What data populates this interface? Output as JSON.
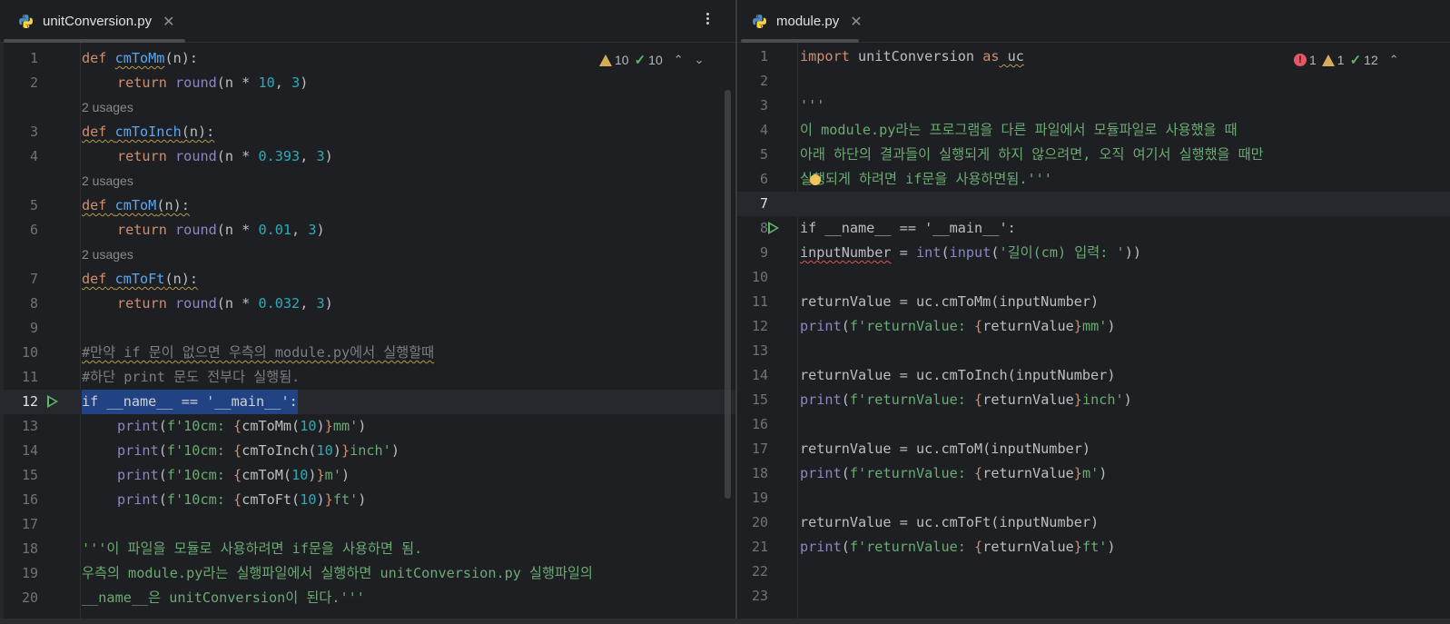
{
  "left": {
    "tab": {
      "label": "unitConversion.py",
      "close": "✕"
    },
    "inspections": {
      "warnings": "10",
      "weak_warnings": "10",
      "up": "⌃",
      "down": "⌄"
    },
    "lines": [
      {
        "n": "1"
      },
      {
        "n": "2"
      },
      {
        "usages": "2 usages"
      },
      {
        "n": "3"
      },
      {
        "n": "4"
      },
      {
        "usages": "2 usages"
      },
      {
        "n": "5"
      },
      {
        "n": "6"
      },
      {
        "usages": "2 usages"
      },
      {
        "n": "7"
      },
      {
        "n": "8"
      },
      {
        "n": "9"
      },
      {
        "n": "10"
      },
      {
        "n": "11"
      },
      {
        "n": "12"
      },
      {
        "n": "13"
      },
      {
        "n": "14"
      },
      {
        "n": "15"
      },
      {
        "n": "16"
      },
      {
        "n": "17"
      },
      {
        "n": "18"
      },
      {
        "n": "19"
      },
      {
        "n": "20"
      }
    ],
    "code": {
      "l1_def": "def",
      "l1_name": "cmToMm",
      "l1_rest": "(n):",
      "l2_return": "return",
      "l2_round": "round",
      "l2_a": "(n * ",
      "l2_num": "10",
      "l2_b": ", ",
      "l2_num2": "3",
      "l2_c": ")",
      "l3_def": "def",
      "l3_name": "cmToInch",
      "l3_rest": "(n):",
      "l4_return": "return",
      "l4_round": "round",
      "l4_a": "(n * ",
      "l4_num": "0.393",
      "l4_b": ", ",
      "l4_num2": "3",
      "l4_c": ")",
      "l5_def": "def",
      "l5_name": "cmToM",
      "l5_rest": "(n):",
      "l6_return": "return",
      "l6_round": "round",
      "l6_a": "(n * ",
      "l6_num": "0.01",
      "l6_b": ", ",
      "l6_num2": "3",
      "l6_c": ")",
      "l7_def": "def",
      "l7_name": "cmToFt",
      "l7_rest": "(n):",
      "l8_return": "return",
      "l8_round": "round",
      "l8_a": "(n * ",
      "l8_num": "0.032",
      "l8_b": ", ",
      "l8_num2": "3",
      "l8_c": ")",
      "l10": "#만약 if 문이 없으면 우측의 module.py에서 실행할때",
      "l11": "#하단 print 문도 전부다 실행됨.",
      "l12": "if __name__ == '__main__':",
      "l13_print": "print",
      "l13_a": "(",
      "l13_s1": "f'10cm: ",
      "l13_ob": "{",
      "l13_call": "cmToMm(",
      "l13_n": "10",
      "l13_cp": ")",
      "l13_cb": "}",
      "l13_s2": "mm'",
      "l13_end": ")",
      "l14_print": "print",
      "l14_a": "(",
      "l14_s1": "f'10cm: ",
      "l14_ob": "{",
      "l14_call": "cmToInch(",
      "l14_n": "10",
      "l14_cp": ")",
      "l14_cb": "}",
      "l14_s2": "inch'",
      "l14_end": ")",
      "l15_print": "print",
      "l15_a": "(",
      "l15_s1": "f'10cm: ",
      "l15_ob": "{",
      "l15_call": "cmToM(",
      "l15_n": "10",
      "l15_cp": ")",
      "l15_cb": "}",
      "l15_s2": "m'",
      "l15_end": ")",
      "l16_print": "print",
      "l16_a": "(",
      "l16_s1": "f'10cm: ",
      "l16_ob": "{",
      "l16_call": "cmToFt(",
      "l16_n": "10",
      "l16_cp": ")",
      "l16_cb": "}",
      "l16_s2": "ft'",
      "l16_end": ")",
      "l18": "'''이 파일을 모듈로 사용하려면 if문을 사용하면 됨.",
      "l19": "우측의 module.py라는 실행파일에서 실행하면 unitConversion.py 실행파일의",
      "l20": "__name__은 unitConversion이 된다.'''"
    }
  },
  "right": {
    "tab": {
      "label": "module.py",
      "close": "✕"
    },
    "inspections": {
      "errors": "1",
      "warnings": "1",
      "weak_warnings": "12",
      "up": "⌃"
    },
    "lines": [
      "1",
      "2",
      "3",
      "4",
      "5",
      "6",
      "7",
      "8",
      "9",
      "10",
      "11",
      "12",
      "13",
      "14",
      "15",
      "16",
      "17",
      "18",
      "19",
      "20",
      "21",
      "22",
      "23"
    ],
    "code": {
      "r1_import": "import",
      "r1_mod": " unitConversion ",
      "r1_as": "as",
      "r1_alias": " uc",
      "r3": "'''",
      "r4": "이 module.py라는 프로그램을 다른 파일에서 모듈파일로 사용했을 때",
      "r5": "아래 하단의 결과들이 실행되게 하지 않으려면, 오직 여기서 실행했을 때만",
      "r6": "실행되게 하려면 if문을 사용하면됨.'''",
      "r8": "if __name__ == '__main__':",
      "r9_var": "inputNumber",
      "r9_eq": " = ",
      "r9_int": "int",
      "r9_a": "(",
      "r9_input": "input",
      "r9_b": "(",
      "r9_str": "'길이(cm) 입력: '",
      "r9_c": "))",
      "r11_a": "returnValue = uc.cmToMm(inputNumber)",
      "r12_print": "print",
      "r12_a": "(",
      "r12_s1": "f'returnValue: ",
      "r12_ob": "{",
      "r12_v": "returnValue",
      "r12_cb": "}",
      "r12_s2": "mm'",
      "r12_c": ")",
      "r14_a": "returnValue = uc.cmToInch(inputNumber)",
      "r15_print": "print",
      "r15_a": "(",
      "r15_s1": "f'returnValue: ",
      "r15_ob": "{",
      "r15_v": "returnValue",
      "r15_cb": "}",
      "r15_s2": "inch'",
      "r15_c": ")",
      "r17_a": "returnValue = uc.cmToM(inputNumber)",
      "r18_print": "print",
      "r18_a": "(",
      "r18_s1": "f'returnValue: ",
      "r18_ob": "{",
      "r18_v": "returnValue",
      "r18_cb": "}",
      "r18_s2": "m'",
      "r18_c": ")",
      "r20_a": "returnValue = uc.cmToFt(inputNumber)",
      "r21_print": "print",
      "r21_a": "(",
      "r21_s1": "f'returnValue: ",
      "r21_ob": "{",
      "r21_v": "returnValue",
      "r21_cb": "}",
      "r21_s2": "ft'",
      "r21_c": ")"
    }
  },
  "colors": {
    "background": "#1e1f22",
    "keyword": "#cf8e6d",
    "function": "#56a8f5",
    "builtin": "#8888c6",
    "number": "#2aacb8",
    "string": "#6aab73",
    "comment": "#7a7e85",
    "selection": "#214283",
    "run": "#5fb865",
    "warning": "#d6ae58",
    "error": "#e55765"
  },
  "icons": [
    "python-file-icon",
    "close-icon",
    "more-actions-icon",
    "warning-icon",
    "error-icon",
    "check-icon",
    "run-icon",
    "chevron-up-icon",
    "chevron-down-icon",
    "lightbulb-icon"
  ]
}
